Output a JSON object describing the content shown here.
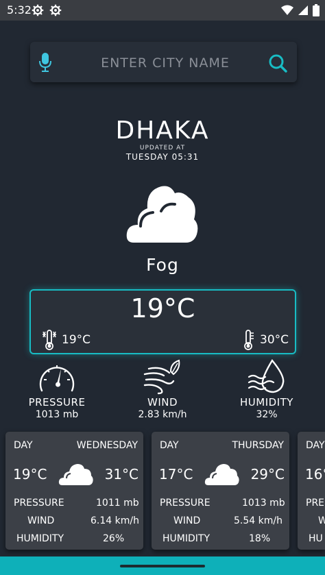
{
  "status_bar": {
    "time": "5:32"
  },
  "search": {
    "placeholder": "ENTER CITY NAME"
  },
  "location": {
    "city": "DHAKA",
    "updated_label": "UPDATED AT",
    "updated_time": "TUESDAY 05:31"
  },
  "current": {
    "condition": "Fog",
    "temp": "19°C",
    "temp_min": "19°C",
    "temp_max": "30°C",
    "icon": "cloud-icon"
  },
  "stats": {
    "pressure": {
      "label": "PRESSURE",
      "value": "1013 mb"
    },
    "wind": {
      "label": "WIND",
      "value": "2.83 km/h"
    },
    "humidity": {
      "label": "HUMIDITY",
      "value": "32%"
    }
  },
  "forecast": [
    {
      "day_label": "DAY",
      "day": "WEDNESDAY",
      "min": "19°C",
      "max": "31°C",
      "pressure_label": "PRESSURE",
      "pressure": "1011 mb",
      "wind_label": "WIND",
      "wind": "6.14 km/h",
      "humidity_label": "HUMIDITY",
      "humidity": "26%"
    },
    {
      "day_label": "DAY",
      "day": "THURSDAY",
      "min": "17°C",
      "max": "29°C",
      "pressure_label": "PRESSURE",
      "pressure": "1013 mb",
      "wind_label": "WIND",
      "wind": "5.54 km/h",
      "humidity_label": "HUMIDITY",
      "humidity": "18%"
    },
    {
      "day_label": "DAY",
      "min": "16°",
      "pressure_label": "PRE",
      "wind_label": "W",
      "humidity_label": "HU"
    }
  ],
  "colors": {
    "background": "#212832",
    "accent": "#18bcc4",
    "card": "#3c4047",
    "nav_bar": "#0eb0b9"
  }
}
